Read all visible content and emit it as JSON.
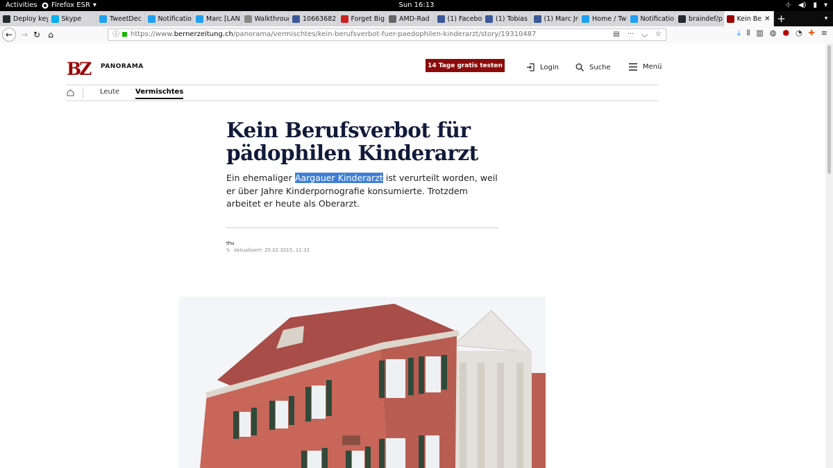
{
  "gnome": {
    "activities": "Activities",
    "app_name": "Firefox ESR",
    "clock": "Sun 16:13"
  },
  "tabs": [
    {
      "title": "Deploy key",
      "icon": "github",
      "color": "#24292e"
    },
    {
      "title": "Skype",
      "icon": "skype",
      "color": "#00aff0"
    },
    {
      "title": "TweetDec",
      "icon": "tweetdeck",
      "color": "#1da1f2"
    },
    {
      "title": "Notificatio",
      "icon": "twitter",
      "color": "#1da1f2"
    },
    {
      "title": "Marc [LAN",
      "icon": "twitter",
      "color": "#1da1f2"
    },
    {
      "title": "Walkthrough",
      "icon": "page",
      "color": "#888888"
    },
    {
      "title": "10663682",
      "icon": "facebook",
      "color": "#3b5998"
    },
    {
      "title": "Forget Big",
      "icon": "t",
      "color": "#cc2222"
    },
    {
      "title": "AMD-Rad",
      "icon": "wikipedia",
      "color": "#666666"
    },
    {
      "title": "(1) Facebo",
      "icon": "facebook",
      "color": "#3b5998"
    },
    {
      "title": "(1) Tobias",
      "icon": "facebook",
      "color": "#3b5998"
    },
    {
      "title": "(1) Marc Jr",
      "icon": "facebook",
      "color": "#3b5998"
    },
    {
      "title": "Home / Tw",
      "icon": "twitter",
      "color": "#1da1f2"
    },
    {
      "title": "Notificatio",
      "icon": "twitter",
      "color": "#1da1f2"
    },
    {
      "title": "braindef/p",
      "icon": "github",
      "color": "#24292e"
    },
    {
      "title": "Kein Be",
      "icon": "bz",
      "color": "#990000",
      "active": true
    }
  ],
  "address": {
    "prefix": "https://www.",
    "domain": "bernerzeitung.ch",
    "path": "/panorama/vermischtes/kein-berufsverbot-fuer-paedophilen-kinderarzt/story/19310487"
  },
  "site": {
    "logo": "BZ",
    "section": "PANORAMA",
    "promo": "14 Tage gratis testen",
    "login": "Login",
    "search": "Suche",
    "menu": "Menü",
    "subnav": [
      "Leute",
      "Vermischtes"
    ]
  },
  "article": {
    "headline": "Kein Berufsverbot für pädophilen Kinderarzt",
    "lead_before": "Ein ehemaliger ",
    "lead_selected": "Aargauer Kinderarzt",
    "lead_after": " ist verurteilt worden, weil er über Jahre Kinderpornografie konsumierte. Trotzdem arbeitet er heute als Oberarzt.",
    "author": "thu",
    "updated": "Aktualisiert: 25.02.2015, 11:33"
  },
  "colors": {
    "brand": "#990000",
    "promo": "#8c0a0a",
    "selection": "#3d7fd8",
    "headline": "#111a3a"
  }
}
